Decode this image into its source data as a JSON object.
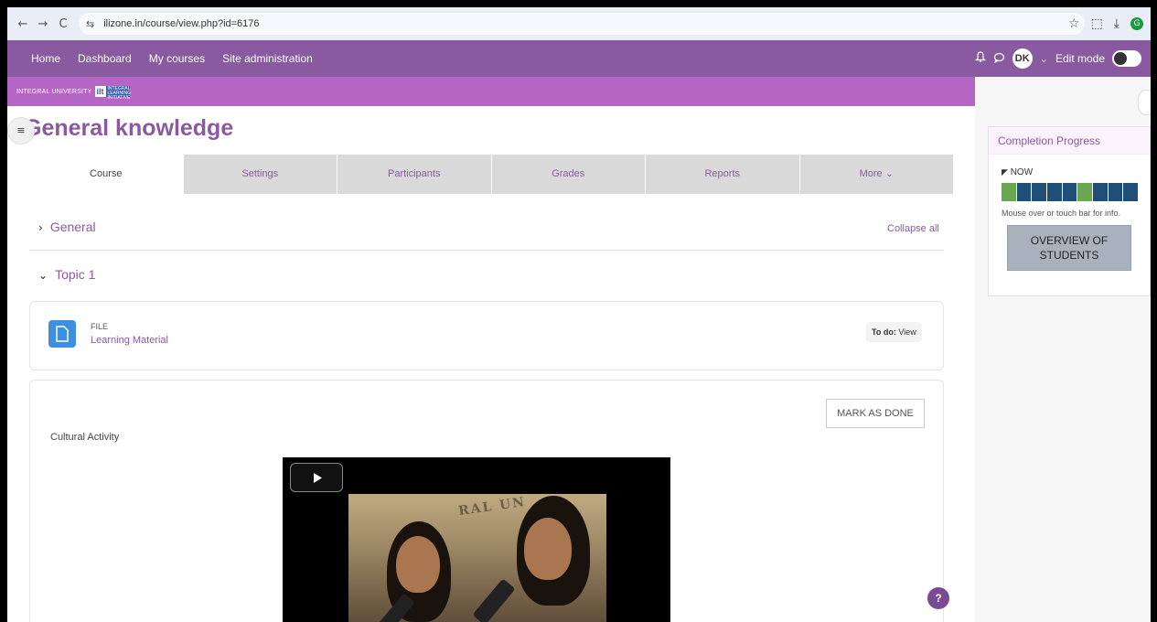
{
  "browser": {
    "url": "ilizone.in/course/view.php?id=6176",
    "back_glyph": "←",
    "forward_glyph": "→",
    "reload_glyph": "C",
    "site_info_glyph": "⇆",
    "star_glyph": "☆",
    "extensions_glyph": "⬚",
    "download_glyph": "⤓",
    "profile_initial": "G"
  },
  "site_nav": {
    "links": [
      "Home",
      "Dashboard",
      "My courses",
      "Site administration"
    ],
    "avatar_initials": "DK",
    "avatar_caret": "⌄",
    "bell_glyph": "🔔",
    "chat_glyph": "💬",
    "edit_mode_label": "Edit mode"
  },
  "logo": {
    "text": "INTEGRAL UNIVERSITY",
    "mark": "ilt",
    "sub": "INTEGRAL LEARNING INITIATIVE"
  },
  "course": {
    "title": "General knowledge",
    "tabs": [
      "Course",
      "Settings",
      "Participants",
      "Grades",
      "Reports",
      "More ⌄"
    ],
    "collapse_all": "Collapse all",
    "sections": [
      {
        "name": "General",
        "chevron": "›"
      },
      {
        "name": "Topic 1",
        "chevron": "⌄"
      }
    ],
    "index_glyph": "≡"
  },
  "file_activity": {
    "type": "FILE",
    "name": "Learning Material",
    "todo_prefix": "To do:",
    "todo_value": "View"
  },
  "label_activity": {
    "mark_button": "MARK AS DONE",
    "label": "Cultural Activity",
    "banner_text": "RAL UN"
  },
  "completion": {
    "title": "Completion Progress",
    "now_flag": "◤",
    "now_label": "NOW",
    "cells": [
      "#6aa84f",
      "#1f4e79",
      "#1f4e79",
      "#1f4e79",
      "#1f4e79",
      "#6aa84f",
      "#1f4e79",
      "#1f4e79",
      "#1f4e79"
    ],
    "hint": "Mouse over or touch bar for info.",
    "overview_line1": "OVERVIEW OF",
    "overview_line2": "STUDENTS"
  },
  "help_glyph": "?",
  "colors": {
    "brand": "#8a5aa0",
    "logo_bar": "#b566c4",
    "file_icon": "#3d8fe0"
  }
}
